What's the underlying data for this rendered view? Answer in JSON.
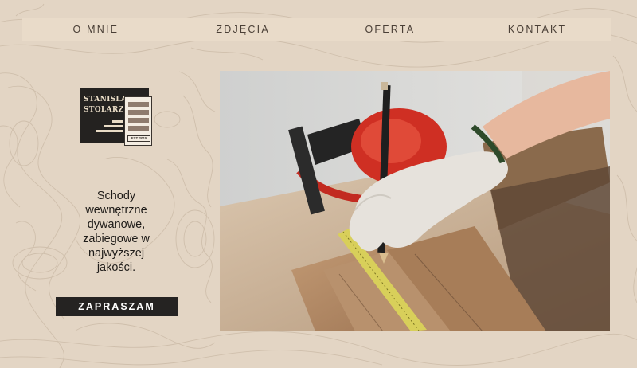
{
  "nav": {
    "items": [
      "O MNIE",
      "ZDJĘCIA",
      "OFERTA",
      "KONTAKT"
    ]
  },
  "logo": {
    "line1": "STANISLAW",
    "line2": "STOLARZ",
    "badge": "EST 2015"
  },
  "hero": {
    "tagline": "Schody wewnętrzne dywanowe, zabiegowe w najwyższej jakości.",
    "cta_label": "ZAPRASZAM"
  },
  "colors": {
    "background": "#e3d5c4",
    "nav_bar": "#e9dbc9",
    "button": "#252322",
    "text": "#1f1c19"
  }
}
